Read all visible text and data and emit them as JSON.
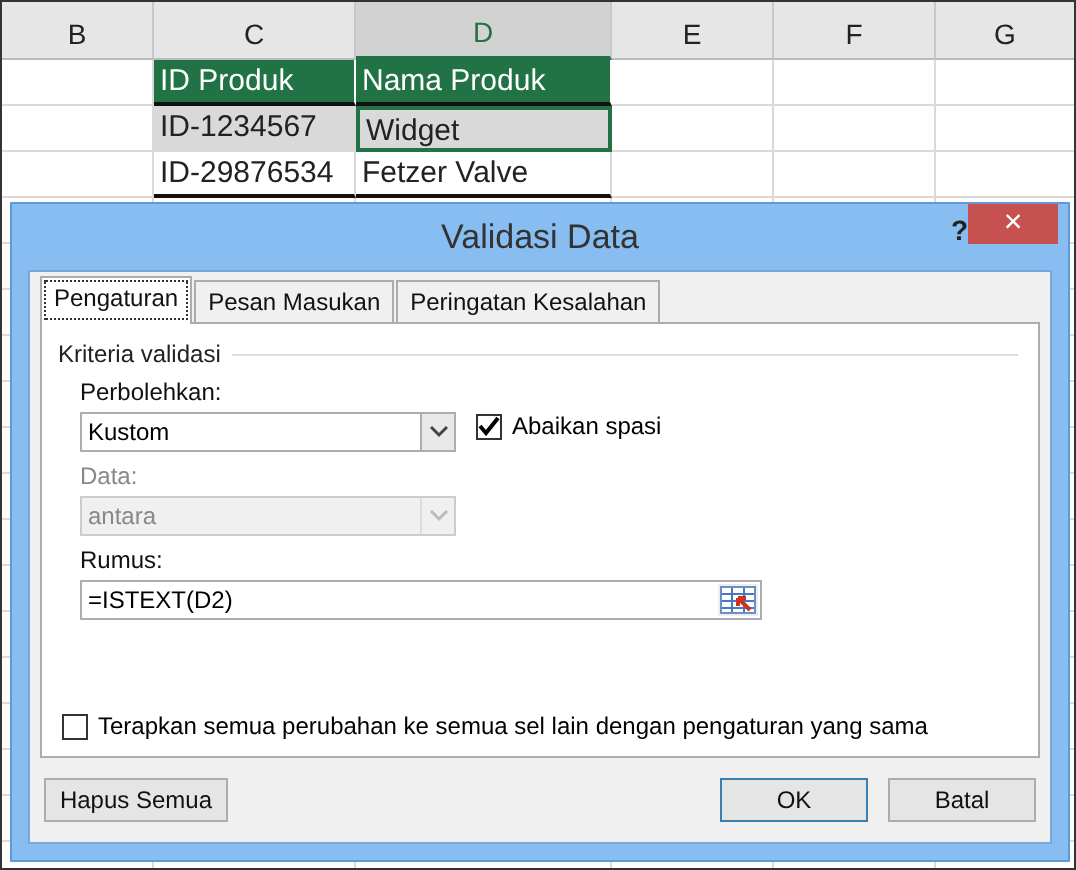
{
  "sheet": {
    "columns": [
      {
        "label": "B",
        "selected": false
      },
      {
        "label": "C",
        "selected": false
      },
      {
        "label": "D",
        "selected": true
      },
      {
        "label": "E",
        "selected": false
      },
      {
        "label": "F",
        "selected": false
      },
      {
        "label": "G",
        "selected": false
      }
    ],
    "rows": [
      {
        "kind": "header",
        "selected": false,
        "cells": [
          "",
          "ID Produk",
          "Nama Produk"
        ]
      },
      {
        "kind": "data",
        "selected": true,
        "cells": [
          "",
          "ID-1234567",
          "Widget"
        ]
      },
      {
        "kind": "data",
        "selected": false,
        "cells": [
          "",
          "ID-29876534",
          "Fetzer Valve"
        ]
      }
    ]
  },
  "dialog": {
    "title": "Validasi Data",
    "help": "?",
    "close": "×",
    "tabs": [
      {
        "label": "Pengaturan",
        "selected": true
      },
      {
        "label": "Pesan Masukan",
        "selected": false
      },
      {
        "label": "Peringatan Kesalahan",
        "selected": false
      }
    ],
    "section": "Kriteria validasi",
    "allow": {
      "label": "Perbolehkan:",
      "value": "Kustom",
      "disabled": false
    },
    "ignore_blank": {
      "label": "Abaikan spasi",
      "checked": true
    },
    "data": {
      "label": "Data:",
      "value": "antara",
      "disabled": true
    },
    "formula": {
      "label": "Rumus:",
      "value": "=ISTEXT(D2)"
    },
    "apply_all": {
      "label": "Terapkan semua perubahan ke semua sel lain dengan pengaturan yang sama",
      "checked": false
    },
    "buttons": [
      {
        "label": "Hapus Semua",
        "kind": "left",
        "default": false
      },
      {
        "label": "OK",
        "kind": "right",
        "default": true
      },
      {
        "label": "Batal",
        "kind": "right",
        "default": false
      }
    ]
  }
}
